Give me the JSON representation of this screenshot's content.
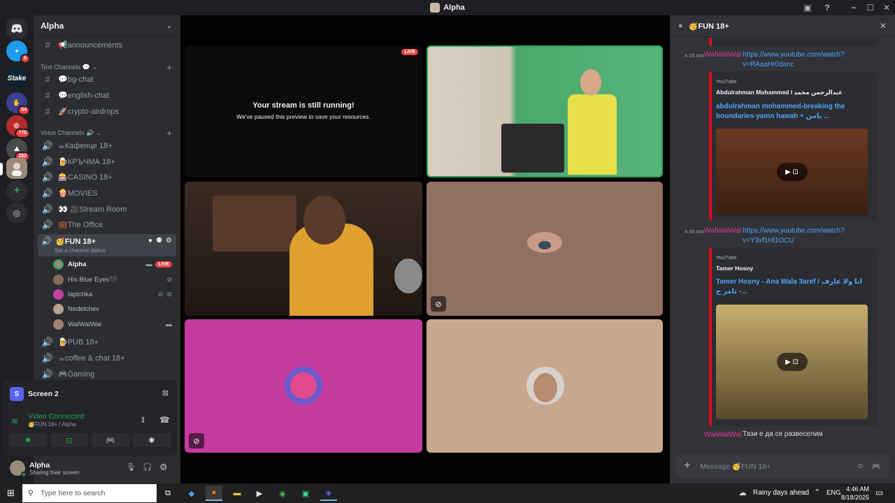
{
  "window": {
    "title": "Alpha",
    "controls": [
      "−",
      "☐",
      "✕"
    ]
  },
  "servers": [
    {
      "label": "",
      "badge": "",
      "color": "#5865f2"
    },
    {
      "label": "",
      "badge": "6",
      "color": "#2a7fd4"
    },
    {
      "label": "Stake",
      "badge": "",
      "color": "#0f212e"
    },
    {
      "label": "",
      "badge": "54",
      "color": "#3a3f8f"
    },
    {
      "label": "",
      "badge": "776",
      "color": "#b52b2b"
    },
    {
      "label": "",
      "badge": "282",
      "color": "#4a4a4a"
    },
    {
      "label": "",
      "badge": "",
      "color": "#9a8a7a"
    }
  ],
  "sidebar": {
    "server_name": "Alpha",
    "announcements": "📢announcements",
    "text_category": "Text Channels 💬",
    "text_channels": [
      "💬bg-chat",
      "💬english-chat",
      "🚀crypto-airdrops"
    ],
    "voice_category": "Voice Channels 🔊",
    "voice_channels": [
      "☕Кафенце 18+",
      "🍺КРЪЧМА 18+",
      "🎰CASINO 18+",
      "🍿MOVIES",
      "👀 🎥Stream Room",
      "💼The Office"
    ],
    "active_channel": "🥳FUN 18+",
    "channel_status": "Set a channel status",
    "voice_users": [
      {
        "name": "Alpha",
        "color": "#9a8a7a",
        "live": "LIVE"
      },
      {
        "name": "His Blue Eyes🖤",
        "color": "#8a6a5a",
        "live": ""
      },
      {
        "name": "lapichka",
        "color": "#c040a0",
        "live": ""
      },
      {
        "name": "Nedelchev",
        "color": "#b8a090",
        "live": ""
      },
      {
        "name": "WalWalWal",
        "color": "#a08070",
        "live": ""
      }
    ],
    "voice_channels_after": [
      "🍺PUB 18+",
      "☕coffee & chat 18+",
      "🎮Gaming"
    ]
  },
  "voice_panel": {
    "screen_label": "Screen 2",
    "status": "Video Connected",
    "channel": "🥳FUN 18+ / Alpha"
  },
  "user": {
    "name": "Alpha",
    "status": "Sharing their screen"
  },
  "stage": {
    "paused_title": "Your stream is still running!",
    "paused_sub": "We've paused this preview to save your resources.",
    "live_badge": "LIVE"
  },
  "chat": {
    "channel": "🥳FUN 18+",
    "messages": [
      {
        "time": "4:15 AM",
        "author": "WalWalWal",
        "link": "https://www.youtube.com/watch?v=RAaaHr0danc",
        "provider": "YouTube",
        "embed_author": "Abdulrahman Mohammed I عبدالرحمن محمد",
        "embed_title": "abdulrahman mohammed-breaking the boundaries-yamn hawah + يامن ..."
      },
      {
        "time": "4:38 AM",
        "author": "WalWalWal",
        "link": "https://www.youtube.com/watch?v=Y3xf1Hl1OCU",
        "provider": "YouTube",
        "embed_author": "Tamer Hosny",
        "embed_title": "Tamer Hosny - Ana Wala 3aref / انا ولا عارف - تامر ح..."
      },
      {
        "time": "",
        "author": "WalWalWal",
        "text": "Тази е да се развеселим"
      }
    ],
    "composer_placeholder": "Message 🥳FUN 18+"
  },
  "taskbar": {
    "search_placeholder": "Type here to search",
    "weather": "Rainy days ahead",
    "lang": "ENG",
    "time": "4:46 AM",
    "date": "8/18/2025"
  }
}
